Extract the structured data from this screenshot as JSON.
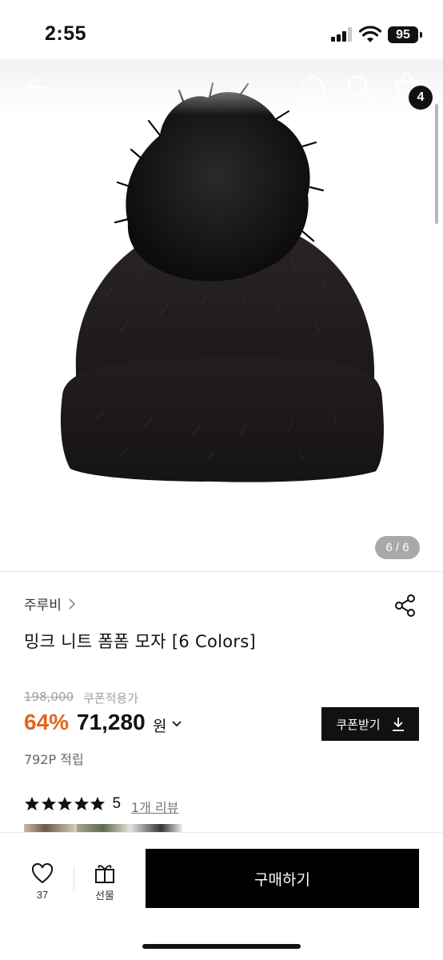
{
  "status_bar": {
    "time": "2:55",
    "battery": "95"
  },
  "header": {
    "cart_count": "4"
  },
  "gallery": {
    "page_indicator": "6 / 6"
  },
  "product": {
    "brand": "주루비",
    "title": "밍크 니트 폼폼 모자 [6 Colors]",
    "original_price": "198,000",
    "coupon_note": "쿠폰적용가",
    "discount": "64%",
    "sale_price": "71,280",
    "currency": "원",
    "points": "792P 적립",
    "rating_value": "5",
    "rating_stars": 5,
    "review_link": "1개 리뷰"
  },
  "buttons": {
    "coupon": "쿠폰받기",
    "buy": "구매하기",
    "gift": "선물",
    "wish_count": "37"
  },
  "icons": {
    "back": "back-arrow-icon",
    "home": "home-icon",
    "search": "search-icon",
    "cart": "shopping-bag-icon",
    "share": "share-icon",
    "heart": "heart-icon",
    "gift": "gift-icon"
  },
  "colors": {
    "discount": "#e2661c",
    "primary": "#000000"
  }
}
